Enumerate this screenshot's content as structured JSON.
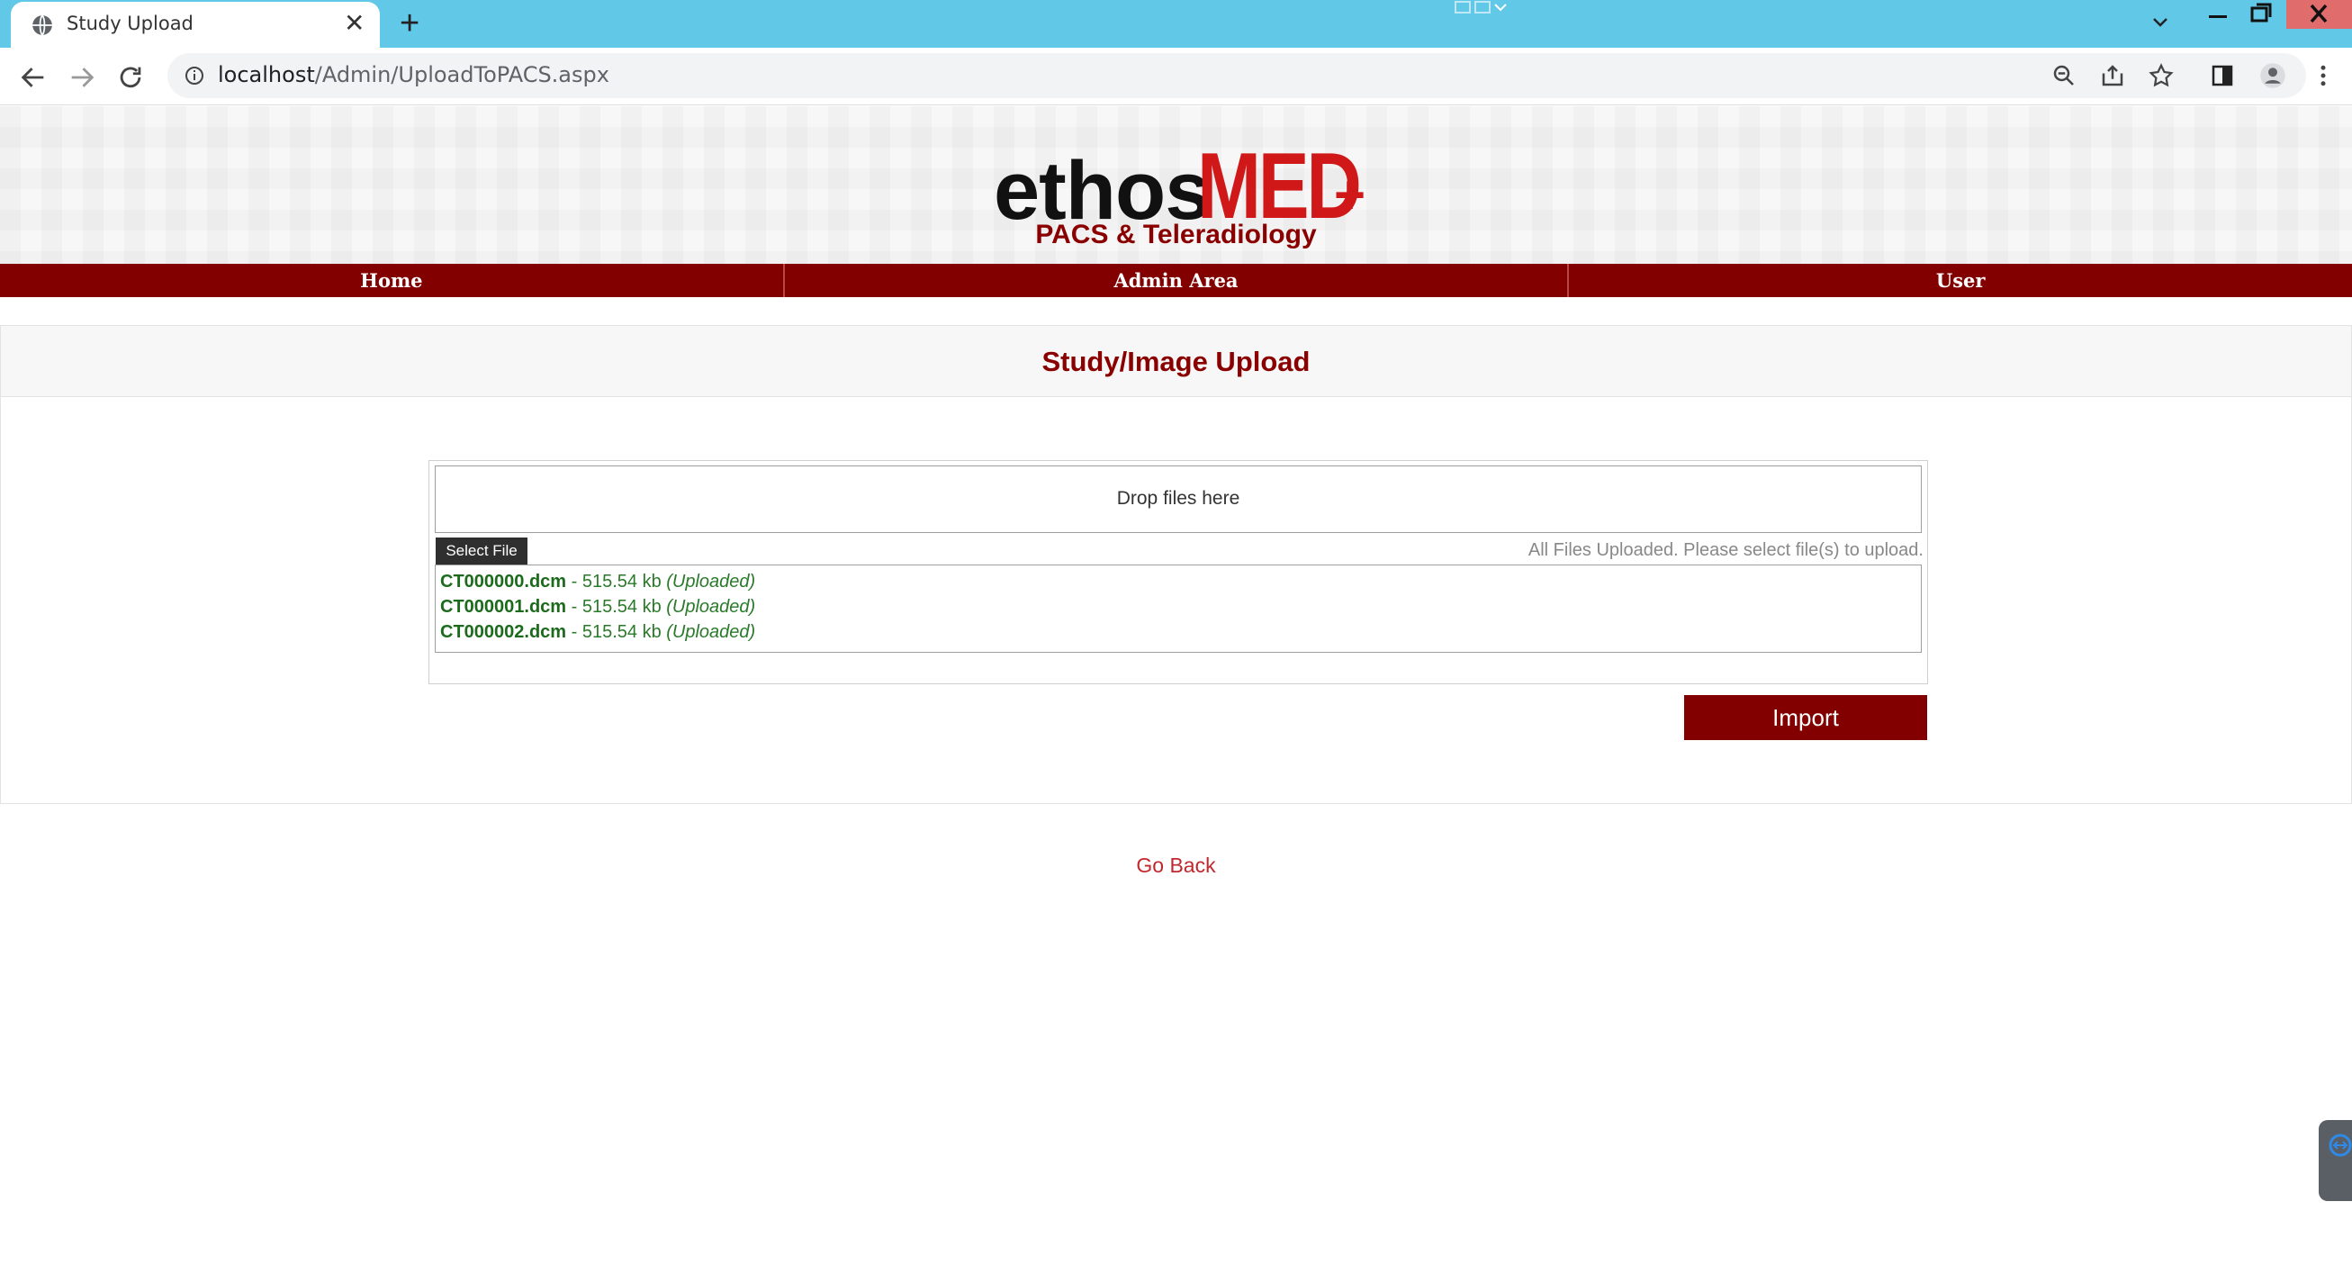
{
  "browser": {
    "tab_title": "Study Upload",
    "tab_close": "✕",
    "new_tab": "+",
    "url_host": "localhost",
    "url_path": "/Admin/UploadToPACS.aspx"
  },
  "header": {
    "logo_primary": "ethos",
    "logo_accent": "MED",
    "logo_plus": "+",
    "tagline": "PACS & Teleradiology"
  },
  "menu": {
    "items": [
      {
        "label": "Home"
      },
      {
        "label": "Admin Area"
      },
      {
        "label": "User"
      }
    ]
  },
  "panel": {
    "title": "Study/Image Upload"
  },
  "uploader": {
    "drop_text": "Drop files here",
    "select_label": "Select File",
    "status_text": "All Files Uploaded. Please select file(s) to upload.",
    "files": [
      {
        "name": "CT000000.dcm",
        "size": " - 515.54 kb ",
        "state": "(Uploaded)"
      },
      {
        "name": "CT000001.dcm",
        "size": " - 515.54 kb ",
        "state": "(Uploaded)"
      },
      {
        "name": "CT000002.dcm",
        "size": " - 515.54 kb ",
        "state": "(Uploaded)"
      }
    ]
  },
  "actions": {
    "import_label": "Import",
    "go_back_label": "Go Back"
  },
  "colors": {
    "brand": "#820000",
    "accent_red": "#d01818",
    "uploaded_green": "#1c6b1c",
    "chrome_bar": "#62c8e8"
  },
  "icons": [
    "globe-icon",
    "back-arrow-icon",
    "forward-arrow-icon",
    "reload-icon",
    "info-icon",
    "zoom-icon",
    "share-icon",
    "star-icon",
    "sidepanel-icon",
    "profile-icon",
    "kebab-menu-icon"
  ]
}
